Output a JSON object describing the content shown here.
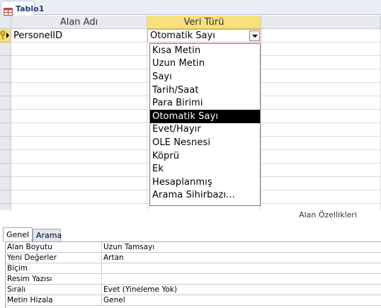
{
  "tab": {
    "title": "Tablo1",
    "icon": "table-icon"
  },
  "grid": {
    "headers": {
      "field_name": "Alan Adı",
      "data_type": "Veri Türü",
      "description": ""
    },
    "rows": [
      {
        "field_name": "PersonelID",
        "data_type": "Otomatik Sayı",
        "is_key": true
      }
    ]
  },
  "dropdown": {
    "options": [
      "Kısa Metin",
      "Uzun Metin",
      "Sayı",
      "Tarih/Saat",
      "Para Birimi",
      "Otomatik Sayı",
      "Evet/Hayır",
      "OLE Nesnesi",
      "Köprü",
      "Ek",
      "Hesaplanmış",
      "Arama Sihirbazı..."
    ],
    "selected": "Otomatik Sayı"
  },
  "properties_label": "Alan Özellikleri",
  "property_tabs": [
    "Genel",
    "Arama"
  ],
  "properties": [
    {
      "label": "Alan Boyutu",
      "value": "Uzun Tamsayı"
    },
    {
      "label": "Yeni Değerler",
      "value": "Artan"
    },
    {
      "label": "Biçim",
      "value": ""
    },
    {
      "label": "Resim Yazısı",
      "value": ""
    },
    {
      "label": "Sıralı",
      "value": "Evet (Yineleme Yok)"
    },
    {
      "label": "Metin Hizala",
      "value": "Genel"
    }
  ],
  "colors": {
    "accent": "#f7e07d",
    "tab_text": "#1f3e72",
    "selection": "#000000"
  }
}
